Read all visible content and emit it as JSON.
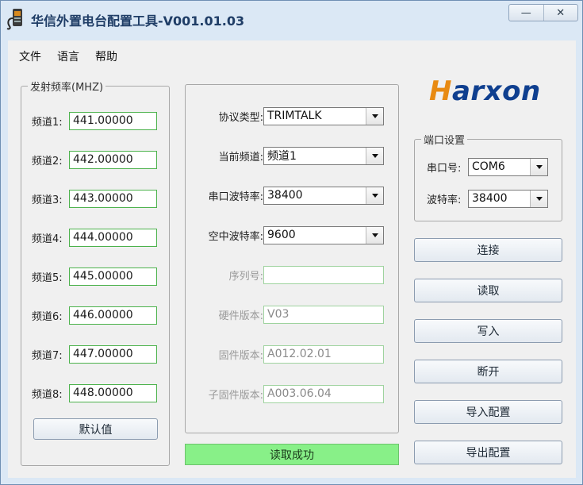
{
  "window": {
    "title": "华信外置电台配置工具-V001.01.03",
    "minimize_glyph": "—",
    "close_glyph": "✕"
  },
  "menu": [
    "文件",
    "语言",
    "帮助"
  ],
  "frequency_group": {
    "legend": "发射频率(MHZ)",
    "channels": [
      {
        "label": "频道1:",
        "value": "441.00000"
      },
      {
        "label": "频道2:",
        "value": "442.00000"
      },
      {
        "label": "频道3:",
        "value": "443.00000"
      },
      {
        "label": "频道4:",
        "value": "444.00000"
      },
      {
        "label": "频道5:",
        "value": "445.00000"
      },
      {
        "label": "频道6:",
        "value": "446.00000"
      },
      {
        "label": "频道7:",
        "value": "447.00000"
      },
      {
        "label": "频道8:",
        "value": "448.00000"
      }
    ],
    "default_button": "默认值"
  },
  "config": {
    "protocol": {
      "label": "协议类型:",
      "value": "TRIMTALK"
    },
    "current_channel": {
      "label": "当前频道:",
      "value": "频道1"
    },
    "serial_baud": {
      "label": "串口波特率:",
      "value": "38400"
    },
    "air_baud": {
      "label": "空中波特率:",
      "value": "9600"
    },
    "serial_no": {
      "label": "序列号:",
      "value": ""
    },
    "hardware_version": {
      "label": "硬件版本:",
      "value": "V03"
    },
    "firmware_version": {
      "label": "固件版本:",
      "value": "A012.02.01"
    },
    "sub_firmware_version": {
      "label": "子固件版本:",
      "value": "A003.06.04"
    }
  },
  "status": {
    "text": "读取成功",
    "color": "#88f088"
  },
  "logo": {
    "prefix": "H",
    "rest": "arxon",
    "brand_blue": "#0f3f8f",
    "brand_orange": "#e88a12"
  },
  "port_group": {
    "legend": "端口设置",
    "port": {
      "label": "串口号:",
      "value": "COM6"
    },
    "baud": {
      "label": "波特率:",
      "value": "38400"
    }
  },
  "actions": {
    "connect": "连接",
    "read": "读取",
    "write": "写入",
    "disconnect": "断开",
    "import": "导入配置",
    "export": "导出配置"
  }
}
